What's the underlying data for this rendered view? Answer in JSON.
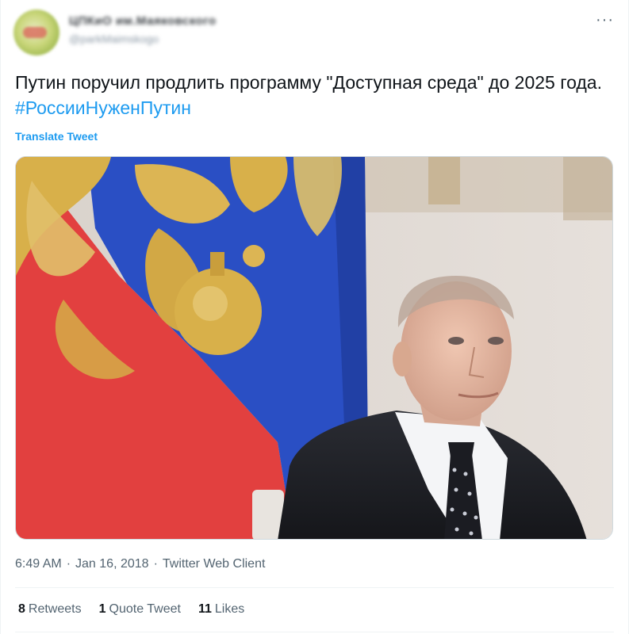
{
  "author": {
    "display_name": "ЦПКиО им.Маяковского",
    "handle": "@parkMaimskogo"
  },
  "menu": {
    "more_label": "···"
  },
  "tweet": {
    "text": "Путин поручил продлить программу \"Доступная среда\" до 2025 года. ",
    "hashtag": "#РоссииНуженПутин",
    "translate_label": "Translate Tweet"
  },
  "meta": {
    "time": "6:49 AM",
    "separator": "·",
    "date": "Jan 16, 2018",
    "client": "Twitter Web Client"
  },
  "stats": {
    "retweets": {
      "count": "8",
      "label": "Retweets"
    },
    "quotes": {
      "count": "1",
      "label": "Quote Tweet"
    },
    "likes": {
      "count": "11",
      "label": "Likes"
    }
  },
  "colors": {
    "accent": "#1d9bf0",
    "text_primary": "#0f1419",
    "text_secondary": "#536471",
    "flag_red": "#e2403f",
    "flag_blue": "#2a4fc4",
    "emblem_gold": "#d8b04a"
  },
  "icons": {
    "more": "ellipsis-icon"
  }
}
